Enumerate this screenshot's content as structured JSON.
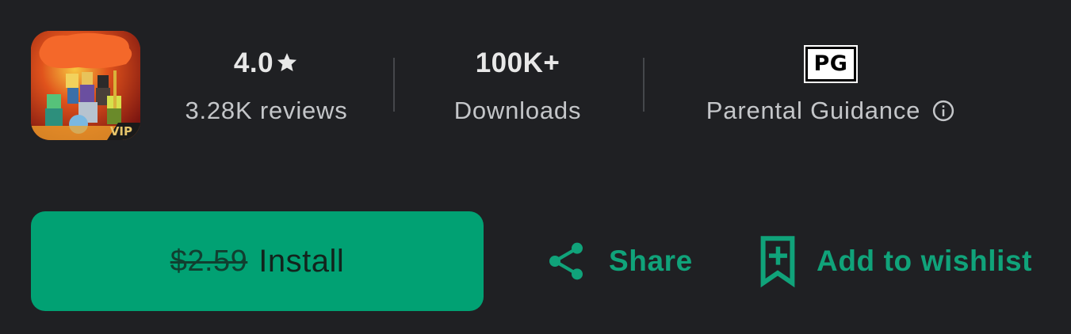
{
  "app": {
    "icon_name": "app-icon-pixel-heroes-vip",
    "icon_badge": "VIP"
  },
  "stats": {
    "rating": {
      "value": "4.0",
      "icon": "star-icon",
      "label": "3.28K reviews"
    },
    "downloads": {
      "value": "100K+",
      "label": "Downloads"
    },
    "content_rating": {
      "badge": "PG",
      "label": "Parental Guidance",
      "icon": "info-icon"
    }
  },
  "actions": {
    "install": {
      "old_price": "$2.59",
      "label": "Install"
    },
    "share": {
      "label": "Share",
      "icon": "share-icon"
    },
    "wishlist": {
      "label": "Add to wishlist",
      "icon": "bookmark-add-icon"
    }
  },
  "colors": {
    "background": "#1f2023",
    "accent": "#01a173",
    "accent_text": "#10a37a",
    "primary_text": "#e8e8e8",
    "secondary_text": "#c4c6c9",
    "divider": "#45474b"
  }
}
